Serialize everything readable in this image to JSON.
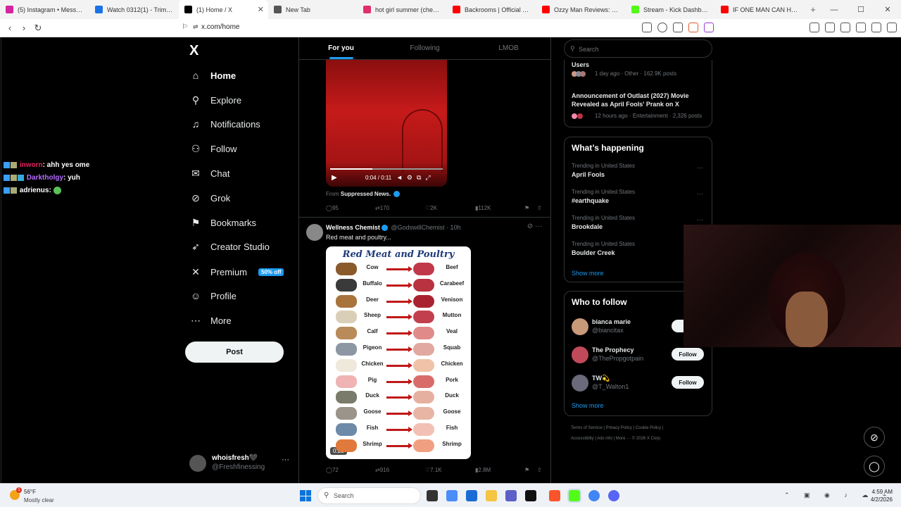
{
  "browser": {
    "tabs": [
      {
        "title": "(5) Instagram • Messages",
        "color": "#d6249f"
      },
      {
        "title": "Watch 0312(1) - Trim | Str",
        "color": "#1a73e8"
      },
      {
        "title": "(1) Home / X",
        "color": "#000000",
        "active": true
      },
      {
        "title": "New Tab",
        "color": "#555555"
      },
      {
        "title": "hot girl summer (chest da",
        "color": "#e1306c"
      },
      {
        "title": "Backrooms | Official Traile",
        "color": "#ff0000"
      },
      {
        "title": "Ozzy Man Reviews: Yanet",
        "color": "#ff0000"
      },
      {
        "title": "Stream - Kick Dashboard",
        "color": "#53fc18"
      },
      {
        "title": "IF ONE MAN CAN HOLD",
        "color": "#ff0000"
      }
    ],
    "url": "x.com/home"
  },
  "chat_overlay": [
    {
      "user": "inworn",
      "msg": ": ahh yes ome",
      "color": "#e0245e"
    },
    {
      "user": "Darktholgy",
      "msg": ": yuh",
      "color": "#b36bff"
    },
    {
      "user": "adrienus",
      "msg": ":",
      "color": "#ffffff"
    }
  ],
  "nav": {
    "logo": "X",
    "items": [
      {
        "label": "Home",
        "icon": "home-icon",
        "glyph": "⌂"
      },
      {
        "label": "Explore",
        "icon": "search-icon",
        "glyph": "⚲"
      },
      {
        "label": "Notifications",
        "icon": "bell-icon",
        "glyph": "♫"
      },
      {
        "label": "Follow",
        "icon": "add-user-icon",
        "glyph": "⚇"
      },
      {
        "label": "Chat",
        "icon": "chat-icon",
        "glyph": "✉"
      },
      {
        "label": "Grok",
        "icon": "grok-icon",
        "glyph": "⊘"
      },
      {
        "label": "Bookmarks",
        "icon": "bookmark-icon",
        "glyph": "⚑"
      },
      {
        "label": "Creator Studio",
        "icon": "rocket-icon",
        "glyph": "➶"
      },
      {
        "label": "Premium",
        "icon": "x-icon",
        "glyph": "✕"
      },
      {
        "label": "Profile",
        "icon": "profile-icon",
        "glyph": "☺"
      },
      {
        "label": "More",
        "icon": "more-icon",
        "glyph": "⋯"
      }
    ],
    "premium_badge": "50% off",
    "post_label": "Post",
    "account": {
      "name": "whoisfresh🖤",
      "handle": "@Freshfinessing",
      "more": "···"
    }
  },
  "feed": {
    "tabs": [
      "For you",
      "Following",
      "LMOB"
    ],
    "tweet1": {
      "video_time": "0:04 / 0:11",
      "from_label": "From",
      "from_source": "Suppressed News.",
      "replies": "95",
      "reposts": "170",
      "likes": "2K",
      "views": "112K"
    },
    "tweet2": {
      "name": "Wellness Chemist",
      "handle": "@GodswillChemist",
      "time": "· 10h",
      "text": "Red meat and poultry...",
      "poster_title": "Red Meat and Poultry",
      "rows": [
        {
          "animal": "Cow",
          "meat": "Beef",
          "acolor": "#8a5a2b",
          "mcolor": "#c0394b"
        },
        {
          "animal": "Buffalo",
          "meat": "Carabeef",
          "acolor": "#3a3a3a",
          "mcolor": "#b8323f"
        },
        {
          "animal": "Deer",
          "meat": "Venison",
          "acolor": "#a8743c",
          "mcolor": "#a8232f"
        },
        {
          "animal": "Sheep",
          "meat": "Mutton",
          "acolor": "#d9cfb8",
          "mcolor": "#c2404d"
        },
        {
          "animal": "Calf",
          "meat": "Veal",
          "acolor": "#b98a5a",
          "mcolor": "#e08a8a"
        },
        {
          "animal": "Pigeon",
          "meat": "Squab",
          "acolor": "#8d96a3",
          "mcolor": "#e0a8a0"
        },
        {
          "animal": "Chicken",
          "meat": "Chicken",
          "acolor": "#efe9dc",
          "mcolor": "#f0c2a8"
        },
        {
          "animal": "Pig",
          "meat": "Pork",
          "acolor": "#f0b3b3",
          "mcolor": "#d96b6b"
        },
        {
          "animal": "Duck",
          "meat": "Duck",
          "acolor": "#7b7b6b",
          "mcolor": "#e6b0a0"
        },
        {
          "animal": "Goose",
          "meat": "Goose",
          "acolor": "#9a948a",
          "mcolor": "#e8b4a4"
        },
        {
          "animal": "Fish",
          "meat": "Fish",
          "acolor": "#6d8aa8",
          "mcolor": "#f2c0b4"
        },
        {
          "animal": "Shrimp",
          "meat": "Shrimp",
          "acolor": "#e07a3c",
          "mcolor": "#f0a080"
        }
      ],
      "duration": "0:23",
      "replies": "72",
      "reposts": "916",
      "likes": "7.1K",
      "views": "2.8M"
    }
  },
  "right": {
    "search_placeholder": "Search",
    "top_panel": {
      "item1_title": "Users",
      "item1_meta": "1 day ago · Other · 162.9K posts",
      "item2_title": "Announcement of Outlast (2027) Movie Revealed as April Fools' Prank on X",
      "item2_meta": "12 hours ago · Entertainment · 2,326 posts"
    },
    "happening": {
      "title": "What’s happening",
      "trends": [
        {
          "context": "Trending in United States",
          "name": "April Fools"
        },
        {
          "context": "Trending in United States",
          "name": "#earthquake"
        },
        {
          "context": "Trending in United States",
          "name": "Brookdale"
        },
        {
          "context": "Trending in United States",
          "name": "Boulder Creek"
        }
      ],
      "show_more": "Show more"
    },
    "who_to_follow": {
      "title": "Who to follow",
      "users": [
        {
          "name": "bianca marie",
          "handle": "@biancitax",
          "btn": "Fo",
          "color": "#c99a7a"
        },
        {
          "name": "The Prophecy",
          "handle": "@ThePropgotpain",
          "btn": "Follow",
          "color": "#c04a5a"
        },
        {
          "name": "TW💫",
          "handle": "@T_Walton1",
          "btn": "Follow",
          "color": "#6a6a7a"
        }
      ],
      "show_more": "Show more"
    },
    "footer_line1": "Terms of Service  |  Privacy Policy  |  Cookie Policy  |",
    "footer_line2": "Accessibility  |  Ads info  |  More ···  © 2026 X Corp."
  },
  "taskbar": {
    "weather_temp": "56°F",
    "weather_desc": "Mostly clear",
    "weather_alert": "1",
    "search_placeholder": "Search",
    "time": "4:59 AM",
    "date": "4/2/2026"
  }
}
